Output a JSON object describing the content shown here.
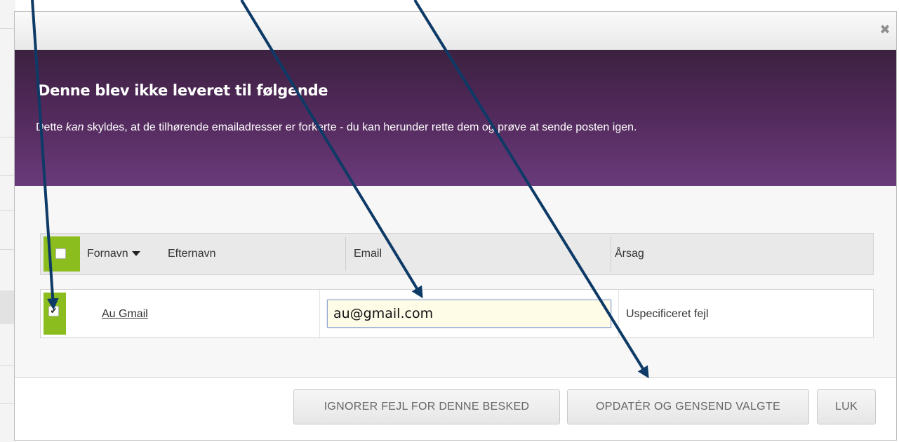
{
  "dialog": {
    "title": "Denne blev ikke leveret til følgende",
    "description_before": "Dette ",
    "description_emphasis": "kan",
    "description_after": " skyldes, at de tilhørende emailadresser er forkerte - du kan herunder rette dem og prøve at sende posten igen.",
    "close_glyph": "✖"
  },
  "table": {
    "columns": {
      "first_name": "Fornavn",
      "last_name": "Efternavn",
      "email": "Email",
      "reason": "Årsag"
    },
    "sort_indicator_icon": "caret-down-icon",
    "rows": [
      {
        "checked": true,
        "check_glyph": "✔",
        "name": "Au Gmail",
        "email": "au@gmail.com",
        "reason": "Uspecificeret fejl"
      }
    ]
  },
  "footer": {
    "ignore_label": "IGNORER FEJL FOR DENNE BESKED",
    "resend_label": "OPDATÉR OG GENSEND VALGTE",
    "close_label": "LUK"
  },
  "colors": {
    "header_gradient_top": "#3c2140",
    "header_gradient_bottom": "#6a3a7a",
    "select_column": "#8cbd1e",
    "annotation_arrow": "#0d3a66"
  }
}
